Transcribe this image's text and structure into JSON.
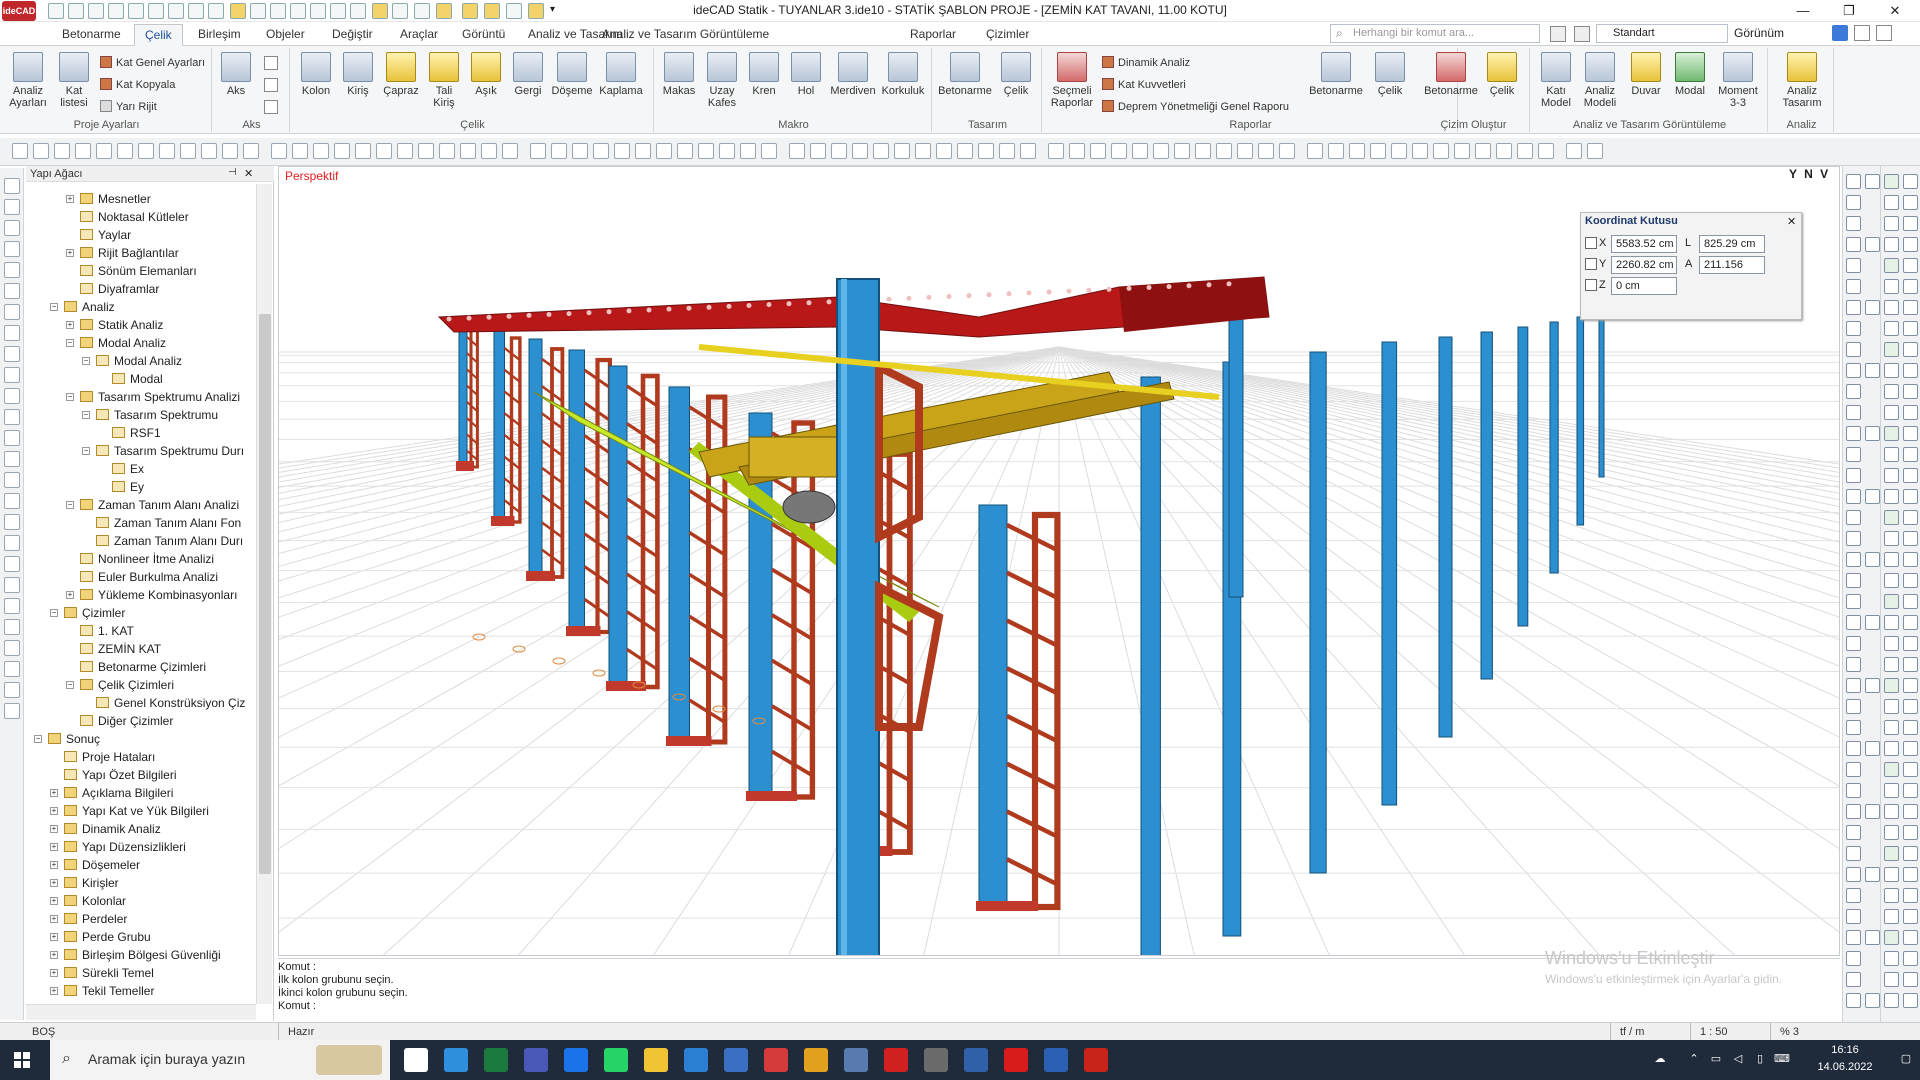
{
  "window": {
    "title": "ideCAD Statik - TUYANLAR 3.ide10 - STATİK ŞABLON PROJE - [ZEMİN KAT TAVANI, 11.00 KOTU]",
    "logo": "ideCAD"
  },
  "menu": {
    "tabs": [
      "Betonarme",
      "Çelik",
      "Birleşim",
      "Objeler",
      "Değiştir",
      "Araçlar",
      "Görüntü",
      "Analiz ve Tasarım",
      "Analiz ve Tasarım Görüntüleme",
      "Raporlar",
      "Çizimler"
    ],
    "active": "Çelik",
    "search_placeholder": "Herhangi bir komut ara...",
    "profile": "Standart",
    "view": "Görünüm"
  },
  "ribbon": {
    "proje_ayarlari": {
      "title": "Proje Ayarları",
      "analiz_ayarlari": "Analiz Ayarları",
      "kat_listesi": "Kat listesi",
      "kat_genel_ayarlari": "Kat Genel Ayarları",
      "kat_kopyala": "Kat Kopyala",
      "yari_rijit": "Yarı Rijit"
    },
    "aks": {
      "title": "Aks",
      "aks": "Aks"
    },
    "celik": {
      "title": "Çelik",
      "items": [
        "Kolon",
        "Kiriş",
        "Çapraz",
        "Tali Kiriş",
        "Aşık",
        "Gergi",
        "Döşeme",
        "Kaplama"
      ]
    },
    "makro": {
      "title": "Makro",
      "items": [
        "Makas",
        "Uzay Kafes",
        "Kren",
        "Hol",
        "Merdiven",
        "Korkuluk"
      ]
    },
    "tasarim": {
      "title": "Tasarım",
      "items": [
        "Betonarme",
        "Çelik"
      ]
    },
    "raporlar": {
      "title": "Raporlar",
      "secmeli": "Seçmeli Raporlar",
      "dinamik": "Dinamik Analiz",
      "kat_kuvvetleri": "Kat Kuvvetleri",
      "deprem": "Deprem Yönetmeliği Genel Raporu",
      "betonarme": "Betonarme",
      "celik": "Çelik"
    },
    "cizim_olustur": {
      "title": "Çizim Oluştur",
      "items": [
        "Betonarme",
        "Çelik"
      ]
    },
    "analiz_goruntuleme": {
      "title": "Analiz ve Tasarım Görüntüleme",
      "items": [
        "Katı Model",
        "Analiz Modeli",
        "Duvar",
        "Modal",
        "Moment 3-3"
      ]
    },
    "analiz": {
      "title": "Analiz",
      "tasarim": "Analiz Tasarım"
    }
  },
  "tree": {
    "title": "Yapı Ağacı",
    "items": [
      {
        "label": "Mesnetler",
        "depth": 2,
        "pm": "+"
      },
      {
        "label": "Noktasal Kütleler",
        "depth": 2,
        "pm": ""
      },
      {
        "label": "Yaylar",
        "depth": 2,
        "pm": ""
      },
      {
        "label": "Rijit Bağlantılar",
        "depth": 2,
        "pm": "+"
      },
      {
        "label": "Sönüm Elemanları",
        "depth": 2,
        "pm": ""
      },
      {
        "label": "Diyaframlar",
        "depth": 2,
        "pm": ""
      },
      {
        "label": "Analiz",
        "depth": 1,
        "pm": "−"
      },
      {
        "label": "Statik Analiz",
        "depth": 2,
        "pm": "+"
      },
      {
        "label": "Modal Analiz",
        "depth": 2,
        "pm": "−"
      },
      {
        "label": "Modal Analiz",
        "depth": 3,
        "pm": "−"
      },
      {
        "label": "Modal",
        "depth": 4,
        "pm": ""
      },
      {
        "label": "Tasarım Spektrumu Analizi",
        "depth": 2,
        "pm": "−"
      },
      {
        "label": "Tasarım Spektrumu",
        "depth": 3,
        "pm": "−"
      },
      {
        "label": "RSF1",
        "depth": 4,
        "pm": ""
      },
      {
        "label": "Tasarım Spektrumu Durı",
        "depth": 3,
        "pm": "−"
      },
      {
        "label": "Ex",
        "depth": 4,
        "pm": ""
      },
      {
        "label": "Ey",
        "depth": 4,
        "pm": ""
      },
      {
        "label": "Zaman Tanım Alanı Analizi",
        "depth": 2,
        "pm": "−"
      },
      {
        "label": "Zaman Tanım Alanı Fon",
        "depth": 3,
        "pm": ""
      },
      {
        "label": "Zaman Tanım Alanı Durı",
        "depth": 3,
        "pm": ""
      },
      {
        "label": "Nonlineer İtme Analizi",
        "depth": 2,
        "pm": ""
      },
      {
        "label": "Euler Burkulma Analizi",
        "depth": 2,
        "pm": ""
      },
      {
        "label": "Yükleme Kombinasyonları",
        "depth": 2,
        "pm": "+"
      },
      {
        "label": "Çizimler",
        "depth": 1,
        "pm": "−"
      },
      {
        "label": "1. KAT",
        "depth": 2,
        "pm": ""
      },
      {
        "label": "ZEMİN KAT",
        "depth": 2,
        "pm": ""
      },
      {
        "label": "Betonarme Çizimleri",
        "depth": 2,
        "pm": ""
      },
      {
        "label": "Çelik Çizimleri",
        "depth": 2,
        "pm": "−"
      },
      {
        "label": "Genel Konstrüksiyon Çiz",
        "depth": 3,
        "pm": ""
      },
      {
        "label": "Diğer Çizimler",
        "depth": 2,
        "pm": ""
      },
      {
        "label": "Sonuç",
        "depth": 0,
        "pm": "−"
      },
      {
        "label": "Proje Hataları",
        "depth": 1,
        "pm": ""
      },
      {
        "label": "Yapı Özet Bilgileri",
        "depth": 1,
        "pm": ""
      },
      {
        "label": "Açıklama Bilgileri",
        "depth": 1,
        "pm": "+"
      },
      {
        "label": "Yapı Kat ve Yük Bilgileri",
        "depth": 1,
        "pm": "+"
      },
      {
        "label": "Dinamik Analiz",
        "depth": 1,
        "pm": "+"
      },
      {
        "label": "Yapı Düzensizlikleri",
        "depth": 1,
        "pm": "+"
      },
      {
        "label": "Döşemeler",
        "depth": 1,
        "pm": "+"
      },
      {
        "label": "Kirişler",
        "depth": 1,
        "pm": "+"
      },
      {
        "label": "Kolonlar",
        "depth": 1,
        "pm": "+"
      },
      {
        "label": "Perdeler",
        "depth": 1,
        "pm": "+"
      },
      {
        "label": "Perde Grubu",
        "depth": 1,
        "pm": "+"
      },
      {
        "label": "Birleşim Bölgesi Güvenliği",
        "depth": 1,
        "pm": "+"
      },
      {
        "label": "Sürekli Temel",
        "depth": 1,
        "pm": "+"
      },
      {
        "label": "Tekil Temeller",
        "depth": 1,
        "pm": "+"
      }
    ]
  },
  "viewport": {
    "label": "Perspektif",
    "ynv": "Y N V"
  },
  "coord_box": {
    "title": "Koordinat Kutusu",
    "x_label": "X",
    "x_value": "5583.52 cm",
    "y_label": "Y",
    "y_value": "2260.82 cm",
    "z_label": "Z",
    "z_value": "0 cm",
    "l_label": "L",
    "l_value": "825.29 cm",
    "a_label": "A",
    "a_value": "211.156"
  },
  "command": {
    "lines": [
      "Komut :",
      "İlk kolon grubunu seçin.",
      "İkinci kolon grubunu seçin.",
      "Komut :"
    ]
  },
  "watermark": {
    "line1": "Windows'u Etkinleştir",
    "line2": "Windows'u etkinleştirmek için Ayarlar'a gidin."
  },
  "status": {
    "left": "BOŞ",
    "mid": "Hazır",
    "unit": "tf / m",
    "scale": "1 : 50",
    "zoom": "% 3"
  },
  "taskbar": {
    "search": "Aramak için buraya yazın",
    "time": "16:16",
    "date": "14.06.2022"
  },
  "colors": {
    "column_blue": "#2b8fd0",
    "beam_red": "#b81818",
    "crane_yellow": "#c9a318",
    "rail_green": "#c8e82a",
    "brace_red": "#b03a1e"
  }
}
